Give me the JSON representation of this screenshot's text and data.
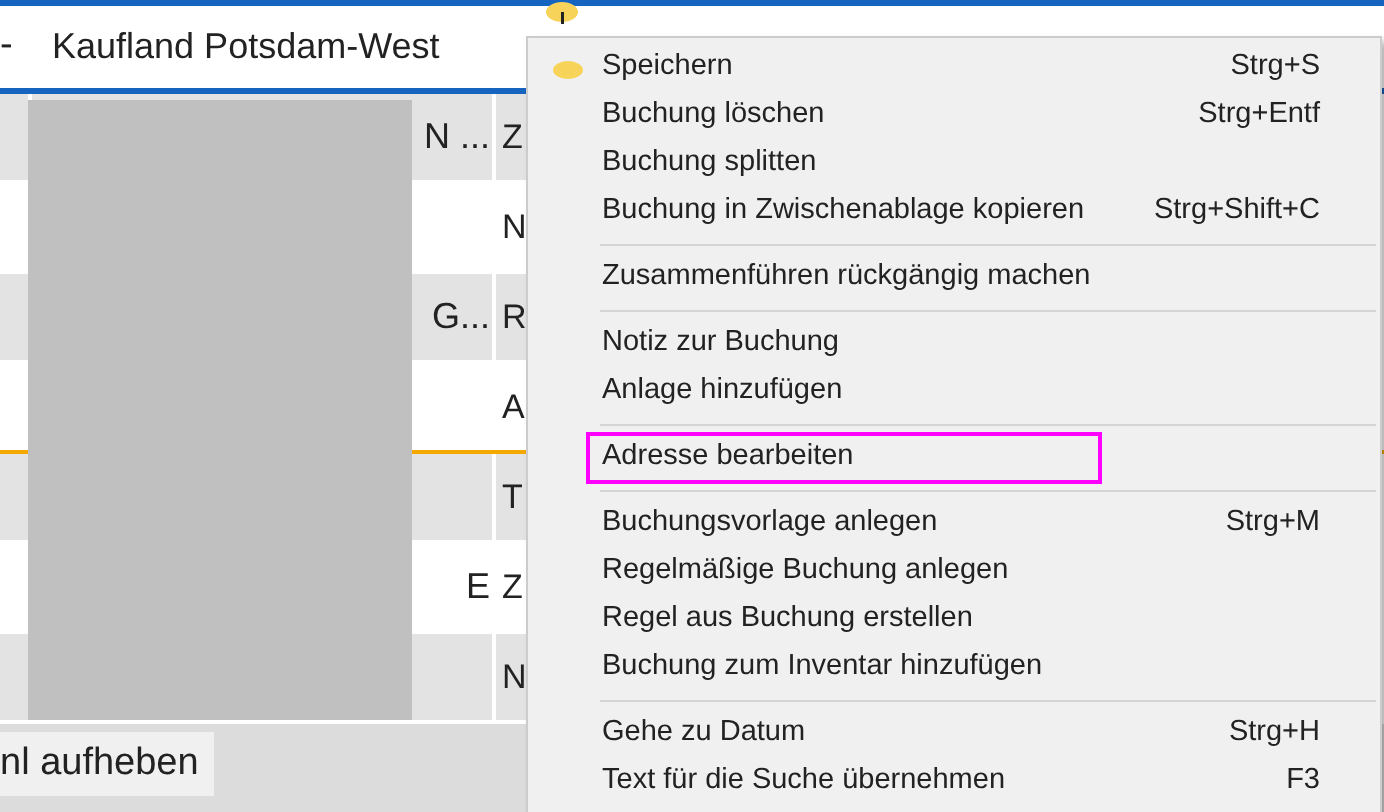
{
  "table": {
    "rows": [
      {
        "selected": true,
        "column_0": "-",
        "column_1": "Kaufland Potsdam-West"
      },
      {
        "selected": false,
        "column_1": "N ...",
        "column_2": "Z"
      },
      {
        "selected": false,
        "column_2": "N"
      },
      {
        "selected": false,
        "column_1": "G...",
        "column_2": "R"
      },
      {
        "selected": false,
        "column_2": "A"
      },
      {
        "selected": false,
        "column_2": "T"
      },
      {
        "selected": false,
        "column_1": "E",
        "column_2": "Z"
      },
      {
        "selected": false,
        "column_2": "N"
      }
    ]
  },
  "bottom_bar": {
    "button": "nl aufheben"
  },
  "context_menu": {
    "items": [
      {
        "kind": "item",
        "label": "Speichern",
        "shortcut": "Strg+S",
        "icon": true,
        "outlined": false
      },
      {
        "kind": "item",
        "label": "Buchung löschen",
        "shortcut": "Strg+Entf",
        "icon": false,
        "outlined": false
      },
      {
        "kind": "item",
        "label": "Buchung splitten",
        "icon": false,
        "outlined": false
      },
      {
        "kind": "item",
        "label": "Buchung in Zwischenablage kopieren",
        "shortcut": "Strg+Shift+C",
        "icon": false,
        "outlined": false
      },
      {
        "kind": "separator"
      },
      {
        "kind": "item",
        "label": "Zusammenführen rückgängig machen",
        "icon": false,
        "outlined": false
      },
      {
        "kind": "separator"
      },
      {
        "kind": "item",
        "label": "Notiz zur Buchung",
        "icon": false,
        "outlined": false
      },
      {
        "kind": "item",
        "label": "Anlage hinzufügen",
        "icon": false,
        "outlined": false
      },
      {
        "kind": "separator"
      },
      {
        "kind": "item",
        "label": "Adresse bearbeiten",
        "icon": false,
        "outlined": true
      },
      {
        "kind": "separator"
      },
      {
        "kind": "item",
        "label": "Buchungsvorlage anlegen",
        "shortcut": "Strg+M",
        "icon": false,
        "outlined": false
      },
      {
        "kind": "item",
        "label": "Regelmäßige Buchung anlegen",
        "icon": false,
        "outlined": false
      },
      {
        "kind": "item",
        "label": "Regel aus Buchung erstellen",
        "icon": false,
        "outlined": false
      },
      {
        "kind": "item",
        "label": "Buchung zum Inventar hinzufügen",
        "icon": false,
        "outlined": false
      },
      {
        "kind": "separator"
      },
      {
        "kind": "item",
        "label": "Gehe zu Datum",
        "shortcut": "Strg+H",
        "icon": false,
        "outlined": false
      },
      {
        "kind": "item",
        "label": "Text für die Suche übernehmen",
        "shortcut": "F3",
        "icon": false,
        "outlined": false
      }
    ]
  }
}
